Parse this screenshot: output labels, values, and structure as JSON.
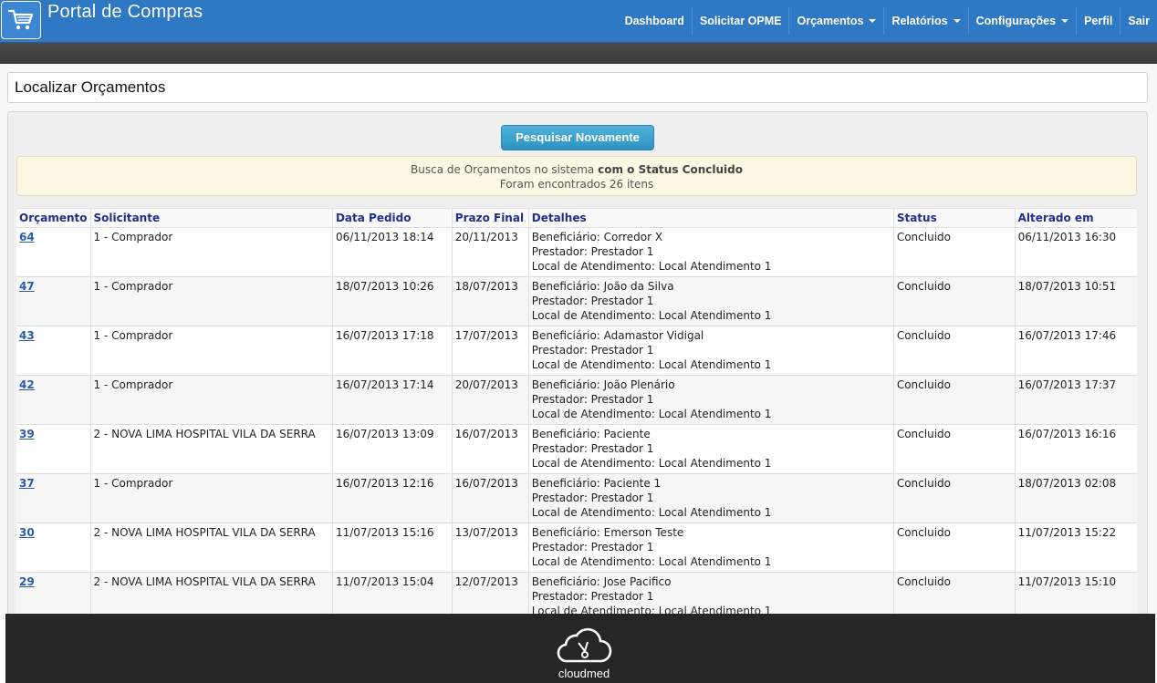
{
  "app": {
    "title": "Portal de Compras",
    "logo_icon": "shopping-cart-icon"
  },
  "nav": {
    "items": [
      {
        "label": "Dashboard",
        "dropdown": false
      },
      {
        "label": "Solicitar OPME",
        "dropdown": false
      },
      {
        "label": "Orçamentos",
        "dropdown": true
      },
      {
        "label": "Relatórios",
        "dropdown": true
      },
      {
        "label": "Configurações",
        "dropdown": true
      },
      {
        "label": "Perfil",
        "dropdown": false
      },
      {
        "label": "Sair",
        "dropdown": false
      }
    ]
  },
  "page": {
    "title": "Localizar Orçamentos",
    "search_again_label": "Pesquisar Novamente"
  },
  "alert": {
    "prefix": "Busca de Orçamentos no sistema ",
    "bold": "com o Status Concluido",
    "count_text": "Foram encontrados 26 itens"
  },
  "table": {
    "headers": [
      "Orçamento",
      "Solicitante",
      "Data Pedido",
      "Prazo Final",
      "Detalhes",
      "Status",
      "Alterado em"
    ],
    "rows": [
      {
        "id": "64",
        "solicitante": "1 - Comprador",
        "data_pedido": "06/11/2013 18:14",
        "prazo_final": "20/11/2013",
        "beneficiario": "Beneficiário: Corredor X",
        "prestador": "Prestador: Prestador 1",
        "local": "Local de Atendimento: Local Atendimento 1",
        "status": "Concluido",
        "alterado": "06/11/2013 16:30"
      },
      {
        "id": "47",
        "solicitante": "1 - Comprador",
        "data_pedido": "18/07/2013 10:26",
        "prazo_final": "18/07/2013",
        "beneficiario": "Beneficiário: João da Silva",
        "prestador": "Prestador: Prestador 1",
        "local": "Local de Atendimento: Local Atendimento 1",
        "status": "Concluido",
        "alterado": "18/07/2013 10:51"
      },
      {
        "id": "43",
        "solicitante": "1 - Comprador",
        "data_pedido": "16/07/2013 17:18",
        "prazo_final": "17/07/2013",
        "beneficiario": "Beneficiário: Adamastor Vidigal",
        "prestador": "Prestador: Prestador 1",
        "local": "Local de Atendimento: Local Atendimento 1",
        "status": "Concluido",
        "alterado": "16/07/2013 17:46"
      },
      {
        "id": "42",
        "solicitante": "1 - Comprador",
        "data_pedido": "16/07/2013 17:14",
        "prazo_final": "20/07/2013",
        "beneficiario": "Beneficiário: João Plenário",
        "prestador": "Prestador: Prestador 1",
        "local": "Local de Atendimento: Local Atendimento 1",
        "status": "Concluido",
        "alterado": "16/07/2013 17:37"
      },
      {
        "id": "39",
        "solicitante": "2 - NOVA LIMA HOSPITAL VILA DA SERRA",
        "data_pedido": "16/07/2013 13:09",
        "prazo_final": "16/07/2013",
        "beneficiario": "Beneficiário: Paciente",
        "prestador": "Prestador: Prestador 1",
        "local": "Local de Atendimento: Local Atendimento 1",
        "status": "Concluido",
        "alterado": "16/07/2013 16:16"
      },
      {
        "id": "37",
        "solicitante": "1 - Comprador",
        "data_pedido": "16/07/2013 12:16",
        "prazo_final": "16/07/2013",
        "beneficiario": "Beneficiário: Paciente 1",
        "prestador": "Prestador: Prestador 1",
        "local": "Local de Atendimento: Local Atendimento 1",
        "status": "Concluido",
        "alterado": "18/07/2013 02:08"
      },
      {
        "id": "30",
        "solicitante": "2 - NOVA LIMA HOSPITAL VILA DA SERRA",
        "data_pedido": "11/07/2013 15:16",
        "prazo_final": "13/07/2013",
        "beneficiario": "Beneficiário: Emerson Teste",
        "prestador": "Prestador: Prestador 1",
        "local": "Local de Atendimento: Local Atendimento 1",
        "status": "Concluido",
        "alterado": "11/07/2013 15:22"
      },
      {
        "id": "29",
        "solicitante": "2 - NOVA LIMA HOSPITAL VILA DA SERRA",
        "data_pedido": "11/07/2013 15:04",
        "prazo_final": "12/07/2013",
        "beneficiario": "Beneficiário: Jose Pacifico",
        "prestador": "Prestador: Prestador 1",
        "local": "Local de Atendimento: Local Atendimento 1",
        "status": "Concluido",
        "alterado": "11/07/2013 15:10"
      }
    ]
  },
  "footer": {
    "brand": "cloudmed",
    "logo_icon": "cloud-stethoscope-icon"
  },
  "colors": {
    "topbar": "#2f78c4",
    "button": "#2e93c3",
    "alert_bg": "#fcf8e3",
    "header_text": "#1f2f8c",
    "link": "#2a5aa8",
    "footer": "#262626"
  }
}
